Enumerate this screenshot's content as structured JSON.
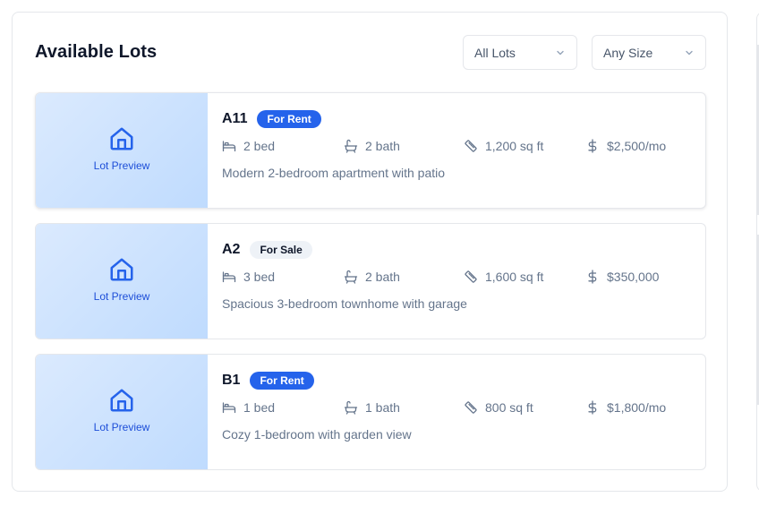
{
  "title": "Available Lots",
  "filters": {
    "lot_filter": "All Lots",
    "size_filter": "Any Size"
  },
  "colors": {
    "accent": "#2563eb",
    "preview_gradient": [
      "#dbeafe",
      "#bfdbfe"
    ]
  },
  "lots": [
    {
      "id": "A11",
      "status": "For Rent",
      "preview_label": "Lot Preview",
      "beds": "2 bed",
      "baths": "2 bath",
      "area": "1,200 sq ft",
      "price": "$2,500/mo",
      "description": "Modern 2-bedroom apartment with patio"
    },
    {
      "id": "A2",
      "status": "For Sale",
      "preview_label": "Lot Preview",
      "beds": "3 bed",
      "baths": "2 bath",
      "area": "1,600 sq ft",
      "price": "$350,000",
      "description": "Spacious 3-bedroom townhome with garage"
    },
    {
      "id": "B1",
      "status": "For Rent",
      "preview_label": "Lot Preview",
      "beds": "1 bed",
      "baths": "1 bath",
      "area": "800 sq ft",
      "price": "$1,800/mo",
      "description": "Cozy 1-bedroom with garden view"
    }
  ],
  "icons": {
    "house": "house-icon",
    "bed": "bed-icon",
    "bath": "bath-icon",
    "area": "ruler-icon",
    "price": "dollar-icon",
    "chevron": "chevron-down-icon"
  }
}
